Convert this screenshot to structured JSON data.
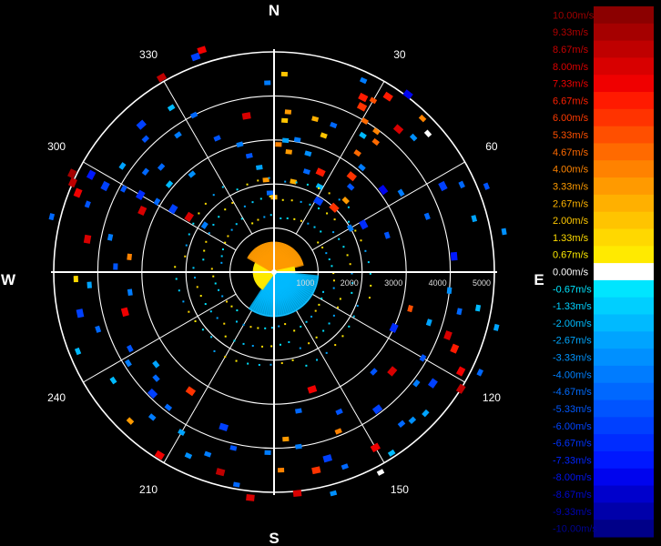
{
  "chart_data": {
    "type": "scatter",
    "projection": "polar",
    "cardinal_labels": {
      "n": "N",
      "e": "E",
      "s": "S",
      "w": "W"
    },
    "azimuth_labels": [
      "30",
      "60",
      "120",
      "150",
      "210",
      "240",
      "300",
      "330"
    ],
    "azimuth_angles": [
      30,
      60,
      120,
      150,
      210,
      240,
      300,
      330
    ],
    "range_rings": [
      1000,
      2000,
      3000,
      4000,
      5000
    ],
    "range_labels": [
      "1000",
      "2000",
      "3000",
      "4000",
      "5000"
    ],
    "range_max": 5000,
    "legend": {
      "labels": [
        "10.00m/s",
        "9.33m/s",
        "8.67m/s",
        "8.00m/s",
        "7.33m/s",
        "6.67m/s",
        "6.00m/s",
        "5.33m/s",
        "4.67m/s",
        "4.00m/s",
        "3.33m/s",
        "2.67m/s",
        "2.00m/s",
        "1.33m/s",
        "0.67m/s",
        "0.00m/s",
        "-0.67m/s",
        "-1.33m/s",
        "-2.00m/s",
        "-2.67m/s",
        "-3.33m/s",
        "-4.00m/s",
        "-4.67m/s",
        "-5.33m/s",
        "-6.00m/s",
        "-6.67m/s",
        "-7.33m/s",
        "-8.00m/s",
        "-8.67m/s",
        "-9.33m/s",
        "-10.00m/s"
      ],
      "colors": [
        "#8b0000",
        "#a50000",
        "#bf0000",
        "#d80000",
        "#f00000",
        "#ff1a00",
        "#ff3300",
        "#ff4f00",
        "#ff6a00",
        "#ff8200",
        "#ff9a00",
        "#ffb000",
        "#ffc400",
        "#ffd800",
        "#ffea00",
        "#ffffff",
        "#00e5ff",
        "#00cfff",
        "#00baff",
        "#00a4ff",
        "#0090ff",
        "#007cff",
        "#0068ff",
        "#0054ff",
        "#0040ff",
        "#002cff",
        "#0018ff",
        "#0004ee",
        "#0000cc",
        "#0000aa",
        "#000088"
      ],
      "text_colors": [
        "#a00000",
        "#b00000",
        "#c80000",
        "#dc0000",
        "#f00000",
        "#ff2000",
        "#ff3a00",
        "#ff5000",
        "#ff6a00",
        "#ff8400",
        "#ff9c00",
        "#ffb400",
        "#ffc800",
        "#ffdc00",
        "#ffec00",
        "#ffffff",
        "#00e5ff",
        "#00d0ff",
        "#00bcff",
        "#00a8ff",
        "#0094ff",
        "#0080ff",
        "#006cff",
        "#0058ff",
        "#0044ff",
        "#0034ff",
        "#0024ff",
        "#0014f0",
        "#0008d0",
        "#0004b0",
        "#000490"
      ]
    },
    "points": [
      {
        "az": 3,
        "r": 4500,
        "v": 2.0
      },
      {
        "az": 5,
        "r": 3650,
        "v": 3.3
      },
      {
        "az": 4,
        "r": 3450,
        "v": 2.0
      },
      {
        "az": 2,
        "r": 2900,
        "v": 4.0
      },
      {
        "az": 5,
        "r": 3000,
        "v": -2.7
      },
      {
        "az": 7,
        "r": 2750,
        "v": 3.3
      },
      {
        "az": 10,
        "r": 3050,
        "v": -4.0
      },
      {
        "az": 15,
        "r": 3600,
        "v": 2.7
      },
      {
        "az": 25,
        "r": 4800,
        "v": -4.0
      },
      {
        "az": 27,
        "r": 4450,
        "v": 6.7
      },
      {
        "az": 28,
        "r": 4250,
        "v": 6.0
      },
      {
        "az": 30,
        "r": 4500,
        "v": 5.3
      },
      {
        "az": 31,
        "r": 4000,
        "v": 4.7
      },
      {
        "az": 33,
        "r": 3700,
        "v": -2.0
      },
      {
        "az": 36,
        "r": 3950,
        "v": 4.0
      },
      {
        "az": 38,
        "r": 3750,
        "v": 4.7
      },
      {
        "az": 35,
        "r": 3300,
        "v": 4.7
      },
      {
        "az": 40,
        "r": 3100,
        "v": -4.0
      },
      {
        "az": 39,
        "r": 2800,
        "v": 6.0
      },
      {
        "az": 42,
        "r": 2600,
        "v": -5.3
      },
      {
        "az": 45,
        "r": 2300,
        "v": 3.3
      },
      {
        "az": 43,
        "r": 2000,
        "v": 6.0
      },
      {
        "az": 41,
        "r": 4300,
        "v": 8.0
      },
      {
        "az": 33,
        "r": 4750,
        "v": 6.7
      },
      {
        "az": 37,
        "r": 5050,
        "v": -8.0
      },
      {
        "az": 44,
        "r": 4850,
        "v": 4.0
      },
      {
        "az": 48,
        "r": 4700,
        "v": 0.0
      },
      {
        "az": 46,
        "r": 4400,
        "v": -3.3
      },
      {
        "az": 22,
        "r": 3600,
        "v": -4.7
      },
      {
        "az": 20,
        "r": 3300,
        "v": 2.0
      },
      {
        "az": 16,
        "r": 2800,
        "v": -3.3
      },
      {
        "az": 18,
        "r": 2400,
        "v": -4.7
      },
      {
        "az": 12,
        "r": 2100,
        "v": 2.7
      },
      {
        "az": 25,
        "r": 2500,
        "v": 6.7
      },
      {
        "az": 28,
        "r": 2200,
        "v": -2.0
      },
      {
        "az": 32,
        "r": 1900,
        "v": -6.0
      },
      {
        "az": 65,
        "r": 4700,
        "v": -4.7
      },
      {
        "az": 68,
        "r": 5200,
        "v": -5.3
      },
      {
        "az": 63,
        "r": 4300,
        "v": -6.0
      },
      {
        "az": 70,
        "r": 3700,
        "v": -4.7
      },
      {
        "az": 58,
        "r": 3400,
        "v": -4.0
      },
      {
        "az": 53,
        "r": 3100,
        "v": -8.0
      },
      {
        "az": 75,
        "r": 4700,
        "v": -2.7
      },
      {
        "az": 80,
        "r": 5300,
        "v": -3.3
      },
      {
        "az": 72,
        "r": 2700,
        "v": -5.3
      },
      {
        "az": 62,
        "r": 2300,
        "v": -6.7
      },
      {
        "az": 85,
        "r": 4100,
        "v": -7.3
      },
      {
        "az": 60,
        "r": 2000,
        "v": -4.0
      },
      {
        "az": 96,
        "r": 4000,
        "v": -3.3
      },
      {
        "az": 100,
        "r": 4700,
        "v": -2.0
      },
      {
        "az": 104,
        "r": 5200,
        "v": -2.7
      },
      {
        "az": 102,
        "r": 4300,
        "v": -4.7
      },
      {
        "az": 110,
        "r": 4200,
        "v": 8.0
      },
      {
        "az": 113,
        "r": 4450,
        "v": 6.7
      },
      {
        "az": 118,
        "r": 4800,
        "v": 7.3
      },
      {
        "az": 122,
        "r": 5000,
        "v": 8.7
      },
      {
        "az": 116,
        "r": 5200,
        "v": -4.7
      },
      {
        "az": 108,
        "r": 3700,
        "v": -2.7
      },
      {
        "az": 120,
        "r": 3900,
        "v": -5.3
      },
      {
        "az": 125,
        "r": 4400,
        "v": -6.0
      },
      {
        "az": 128,
        "r": 4100,
        "v": -4.0
      },
      {
        "az": 133,
        "r": 4700,
        "v": -2.7
      },
      {
        "az": 130,
        "r": 3500,
        "v": 8.0
      },
      {
        "az": 137,
        "r": 4600,
        "v": -3.3
      },
      {
        "az": 140,
        "r": 4500,
        "v": -4.7
      },
      {
        "az": 147,
        "r": 4900,
        "v": -2.0
      },
      {
        "az": 152,
        "r": 5150,
        "v": 0.0
      },
      {
        "az": 150,
        "r": 4600,
        "v": 7.3
      },
      {
        "az": 143,
        "r": 3900,
        "v": -6.0
      },
      {
        "az": 135,
        "r": 3200,
        "v": -5.3
      },
      {
        "az": 115,
        "r": 3000,
        "v": -6.7
      },
      {
        "az": 105,
        "r": 3200,
        "v": 5.3
      },
      {
        "az": 160,
        "r": 4700,
        "v": -4.7
      },
      {
        "az": 164,
        "r": 4400,
        "v": -6.0
      },
      {
        "az": 168,
        "r": 4600,
        "v": 6.0
      },
      {
        "az": 172,
        "r": 4000,
        "v": -4.0
      },
      {
        "az": 176,
        "r": 3800,
        "v": 3.3
      },
      {
        "az": 178,
        "r": 4500,
        "v": 4.0
      },
      {
        "az": 174,
        "r": 5050,
        "v": 8.0
      },
      {
        "az": 165,
        "r": 5200,
        "v": -3.3
      },
      {
        "az": 158,
        "r": 3900,
        "v": 4.0
      },
      {
        "az": 155,
        "r": 3500,
        "v": -5.3
      },
      {
        "az": 170,
        "r": 3200,
        "v": -4.7
      },
      {
        "az": 162,
        "r": 2800,
        "v": 7.3
      },
      {
        "az": 182,
        "r": 4100,
        "v": -4.0
      },
      {
        "az": 186,
        "r": 5150,
        "v": 8.0
      },
      {
        "az": 190,
        "r": 4900,
        "v": -4.7
      },
      {
        "az": 195,
        "r": 4700,
        "v": 8.7
      },
      {
        "az": 200,
        "r": 4400,
        "v": -4.0
      },
      {
        "az": 193,
        "r": 4100,
        "v": -5.3
      },
      {
        "az": 198,
        "r": 3700,
        "v": -6.0
      },
      {
        "az": 205,
        "r": 4600,
        "v": -3.3
      },
      {
        "az": 212,
        "r": 4900,
        "v": 7.3
      },
      {
        "az": 210,
        "r": 4200,
        "v": -2.7
      },
      {
        "az": 218,
        "r": 3900,
        "v": -4.7
      },
      {
        "az": 220,
        "r": 4300,
        "v": -4.0
      },
      {
        "az": 215,
        "r": 3300,
        "v": 6.0
      },
      {
        "az": 225,
        "r": 3900,
        "v": -6.0
      },
      {
        "az": 228,
        "r": 3600,
        "v": -4.7
      },
      {
        "az": 232,
        "r": 3400,
        "v": -2.7
      },
      {
        "az": 236,
        "r": 4400,
        "v": -2.0
      },
      {
        "az": 224,
        "r": 4700,
        "v": 3.3
      },
      {
        "az": 238,
        "r": 3900,
        "v": -4.0
      },
      {
        "az": 242,
        "r": 3700,
        "v": -5.3
      },
      {
        "az": 248,
        "r": 4800,
        "v": -2.0
      },
      {
        "az": 252,
        "r": 4200,
        "v": -4.7
      },
      {
        "az": 255,
        "r": 3500,
        "v": 7.3
      },
      {
        "az": 258,
        "r": 4500,
        "v": -6.0
      },
      {
        "az": 262,
        "r": 3300,
        "v": -4.0
      },
      {
        "az": 266,
        "r": 4200,
        "v": -2.7
      },
      {
        "az": 268,
        "r": 4500,
        "v": 1.3
      },
      {
        "az": 272,
        "r": 3600,
        "v": -5.3
      },
      {
        "az": 276,
        "r": 3300,
        "v": 4.0
      },
      {
        "az": 280,
        "r": 4300,
        "v": 8.0
      },
      {
        "az": 282,
        "r": 3800,
        "v": -4.0
      },
      {
        "az": 284,
        "r": 5200,
        "v": -4.7
      },
      {
        "az": 290,
        "r": 4500,
        "v": -5.3
      },
      {
        "az": 292,
        "r": 4800,
        "v": 7.3
      },
      {
        "az": 294,
        "r": 5000,
        "v": 8.7
      },
      {
        "az": 296,
        "r": 5100,
        "v": 9.3
      },
      {
        "az": 297,
        "r": 4300,
        "v": -6.0
      },
      {
        "az": 299,
        "r": 3900,
        "v": -5.3
      },
      {
        "az": 300,
        "r": 3500,
        "v": -6.7
      },
      {
        "az": 301,
        "r": 3100,
        "v": -4.7
      },
      {
        "az": 302,
        "r": 2700,
        "v": -6.0
      },
      {
        "az": 303,
        "r": 2300,
        "v": 8.0
      },
      {
        "az": 304,
        "r": 1900,
        "v": -4.0
      },
      {
        "az": 298,
        "r": 4700,
        "v": -7.3
      },
      {
        "az": 295,
        "r": 3300,
        "v": 8.0
      },
      {
        "az": 305,
        "r": 4200,
        "v": -2.7
      },
      {
        "az": 308,
        "r": 3700,
        "v": -4.7
      },
      {
        "az": 310,
        "r": 3100,
        "v": -2.0
      },
      {
        "az": 313,
        "r": 3500,
        "v": -4.7
      },
      {
        "az": 316,
        "r": 4200,
        "v": -5.3
      },
      {
        "az": 318,
        "r": 4500,
        "v": -6.0
      },
      {
        "az": 320,
        "r": 2900,
        "v": -3.3
      },
      {
        "az": 325,
        "r": 3800,
        "v": -4.0
      },
      {
        "az": 328,
        "r": 4400,
        "v": -2.0
      },
      {
        "az": 330,
        "r": 5100,
        "v": 8.7
      },
      {
        "az": 333,
        "r": 4000,
        "v": -4.7
      },
      {
        "az": 337,
        "r": 3300,
        "v": -5.3
      },
      {
        "az": 340,
        "r": 5200,
        "v": -6.0
      },
      {
        "az": 342,
        "r": 5300,
        "v": 7.3
      },
      {
        "az": 345,
        "r": 3000,
        "v": -4.0
      },
      {
        "az": 348,
        "r": 2700,
        "v": -5.3
      },
      {
        "az": 350,
        "r": 3600,
        "v": 8.0
      },
      {
        "az": 352,
        "r": 2400,
        "v": -2.7
      },
      {
        "az": 355,
        "r": 2100,
        "v": 3.3
      },
      {
        "az": 357,
        "r": 1800,
        "v": -4.7
      },
      {
        "az": 0,
        "r": 1700,
        "v": 2.7
      },
      {
        "az": 358,
        "r": 4300,
        "v": -4.0
      }
    ]
  }
}
